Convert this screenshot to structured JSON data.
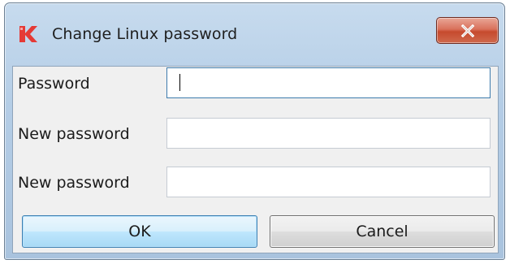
{
  "window": {
    "title": "Change Linux password",
    "app_icon": "red-k-logo-icon",
    "close_icon": "close-icon"
  },
  "form": {
    "fields": [
      {
        "label": "Password",
        "value": "",
        "focused": true
      },
      {
        "label": "New password",
        "value": "",
        "focused": false
      },
      {
        "label": "New password",
        "value": "",
        "focused": false
      }
    ]
  },
  "buttons": {
    "ok_label": "OK",
    "cancel_label": "Cancel"
  },
  "colors": {
    "title_bar": "#b4cde6",
    "close_button": "#c64a2e",
    "ok_button": "#bee6fd",
    "focus_border": "#3d7bad"
  }
}
